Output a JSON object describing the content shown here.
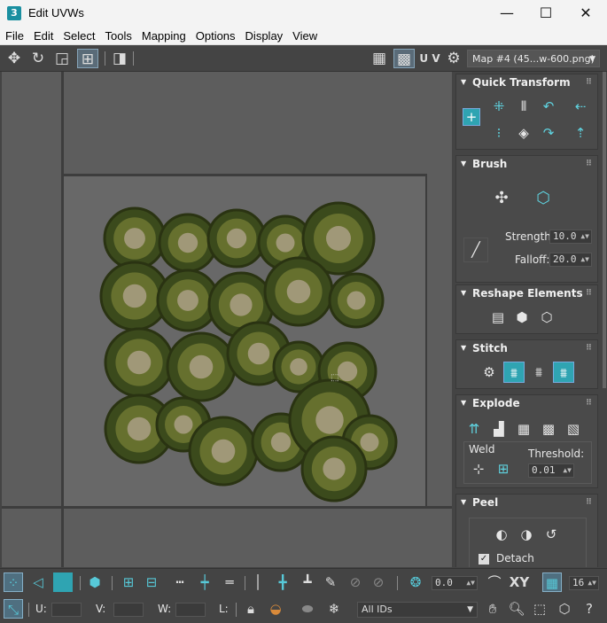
{
  "window": {
    "app_icon": "3",
    "title": "Edit UVWs",
    "minimize": "—",
    "maximize": "☐",
    "close": "✕"
  },
  "menu": [
    "File",
    "Edit",
    "Select",
    "Tools",
    "Mapping",
    "Options",
    "Display",
    "View"
  ],
  "toolbar": {
    "uv_label": "U V",
    "map_selector": "Map #4 (45...w-600.png)"
  },
  "panel": {
    "quick_transform": {
      "title": "Quick Transform"
    },
    "brush": {
      "title": "Brush",
      "strength_label": "Strength:",
      "strength_value": "10.0",
      "falloff_label": "Falloff:",
      "falloff_value": "20.0"
    },
    "reshape": {
      "title": "Reshape Elements"
    },
    "stitch": {
      "title": "Stitch"
    },
    "explode": {
      "title": "Explode",
      "weld_label": "Weld",
      "threshold_label": "Threshold:",
      "threshold_value": "0.01"
    },
    "peel": {
      "title": "Peel",
      "detach_label": "Detach",
      "detach_checked": true
    }
  },
  "bottom": {
    "rotate_value": "0.0",
    "xy_label": "XY",
    "grid_value": "16",
    "u_label": "U:",
    "v_label": "V:",
    "w_label": "W:",
    "l_label": "L:",
    "ids_dropdown": "All IDs"
  },
  "colors": {
    "accent": "#5fd3e0",
    "panel_bg": "#444444",
    "viewport_bg": "#5d5d5d"
  }
}
